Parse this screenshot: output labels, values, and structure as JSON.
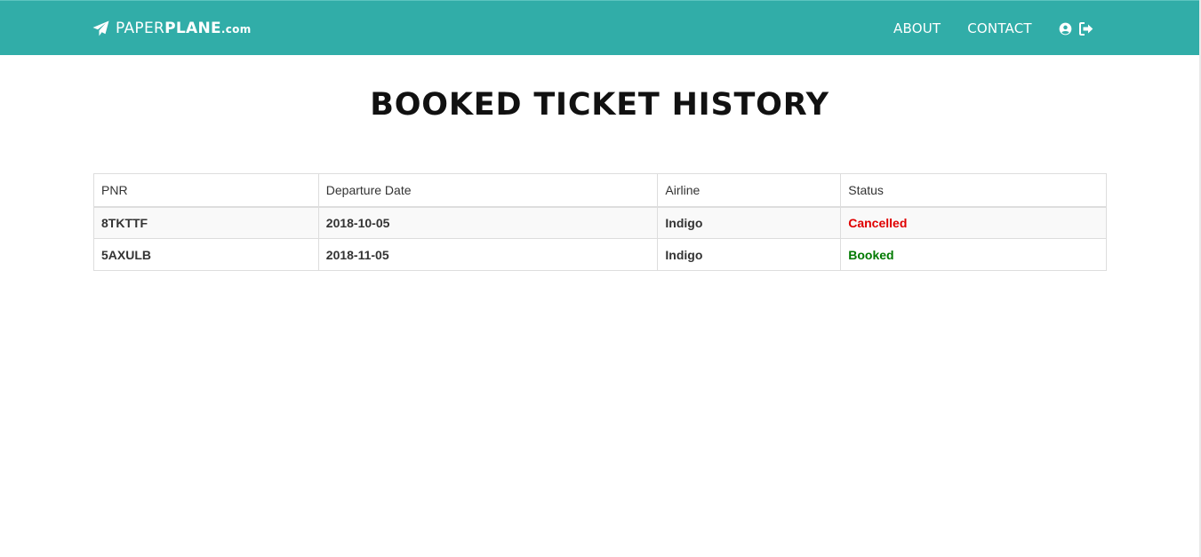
{
  "navbar": {
    "brand": {
      "prefix": "PAPER",
      "name": "PLANE",
      "suffix": ".com"
    },
    "links": [
      {
        "label": "ABOUT"
      },
      {
        "label": "CONTACT"
      }
    ],
    "icons": [
      "user-circle-icon",
      "sign-out-icon"
    ],
    "background": "#31ada8"
  },
  "page": {
    "title": "BOOKED TICKET HISTORY"
  },
  "table": {
    "headers": [
      "PNR",
      "Departure Date",
      "Airline",
      "Status"
    ],
    "rows": [
      {
        "pnr": "8TKTTF",
        "date": "2018-10-05",
        "airline": "Indigo",
        "status": "Cancelled"
      },
      {
        "pnr": "5AXULB",
        "date": "2018-11-05",
        "airline": "Indigo",
        "status": "Booked"
      }
    ]
  },
  "colors": {
    "cancelled": "#e00000",
    "booked": "#007a00"
  }
}
